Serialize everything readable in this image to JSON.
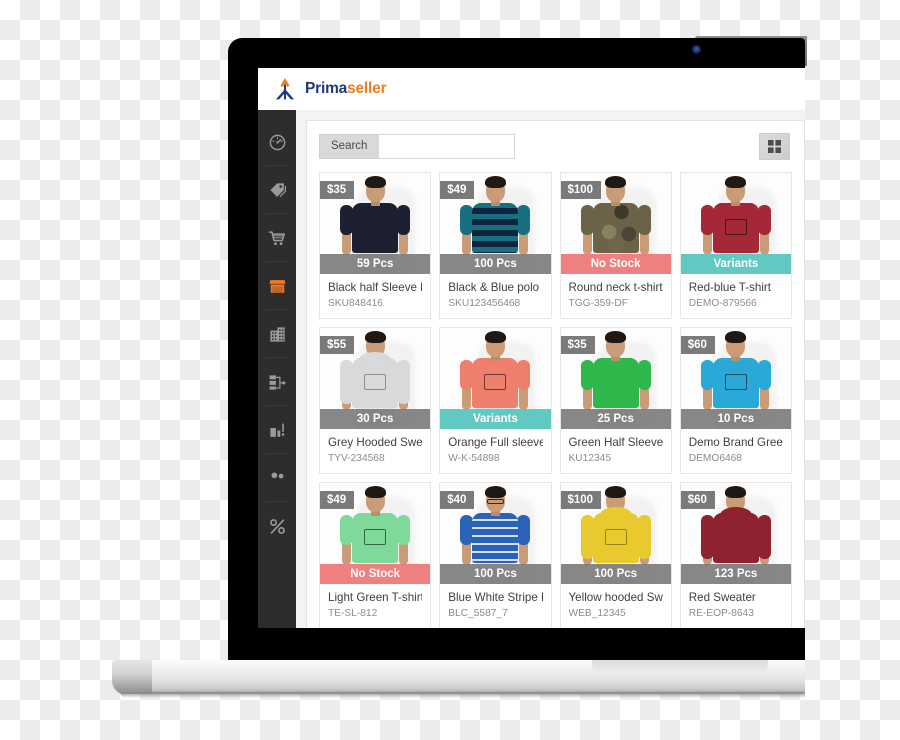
{
  "app": {
    "logo_prima": "Prima",
    "logo_seller": "seller",
    "logo_mark_icon": "primaseller-arrow-icon"
  },
  "sidebar": {
    "items": [
      {
        "icon": "dashboard-gauge-icon",
        "active": false
      },
      {
        "icon": "tag-icon",
        "active": false
      },
      {
        "icon": "shopping-cart-icon",
        "active": false
      },
      {
        "icon": "store-icon",
        "active": true
      },
      {
        "icon": "building-icon",
        "active": false
      },
      {
        "icon": "hierarchy-icon",
        "active": false
      },
      {
        "icon": "bar-chart-icon",
        "active": false
      },
      {
        "icon": "people-icon",
        "active": false
      },
      {
        "icon": "percent-icon",
        "active": false
      }
    ],
    "active_color": "#f47a20",
    "idle_color": "#9a9a9a",
    "background": "#2d2d2d"
  },
  "toolbar": {
    "search_label": "Search",
    "search_value": "",
    "search_placeholder": "",
    "grid_view_icon": "grid-view-icon"
  },
  "colors": {
    "badge_grey": "#767676",
    "badge_red": "#f08080",
    "badge_teal": "#62c8c2",
    "price_tag": "#7a7a7a"
  },
  "products": [
    {
      "price": "$35",
      "stock_label": "59 Pcs",
      "stock_state": "grey",
      "title": "Black half Sleeve Polo",
      "sku": "SKU848416",
      "shirt_color": "#1c2030",
      "style": "polo"
    },
    {
      "price": "$49",
      "stock_label": "100 Pcs",
      "stock_state": "grey",
      "title": "Black & Blue polo",
      "sku": "SKU123456468",
      "shirt_color": "#17707f",
      "style": "striped"
    },
    {
      "price": "$100",
      "stock_label": "No Stock",
      "stock_state": "red",
      "title": "Round neck t-shirt",
      "sku": "TGG-359-DF",
      "shirt_color": "#6b6248",
      "style": "camo"
    },
    {
      "price": "",
      "stock_label": "Variants",
      "stock_state": "teal",
      "title": "Red-blue T-shirt",
      "sku": "DEMO-879566",
      "shirt_color": "#a52839",
      "style": "graphic"
    },
    {
      "price": "$55",
      "stock_label": "30 Pcs",
      "stock_state": "grey",
      "title": "Grey Hooded Sweater",
      "sku": "TYV-234568",
      "shirt_color": "#d7d9da",
      "style": "hoodie"
    },
    {
      "price": "",
      "stock_label": "Variants",
      "stock_state": "teal",
      "title": "Orange Full sleeve",
      "sku": "W-K-54898",
      "shirt_color": "#ee7f6d",
      "style": "graphic"
    },
    {
      "price": "$35",
      "stock_label": "25 Pcs",
      "stock_state": "grey",
      "title": "Green Half Sleeve Polo",
      "sku": "KU12345",
      "shirt_color": "#2eb84c",
      "style": "polo"
    },
    {
      "price": "$60",
      "stock_label": "10 Pcs",
      "stock_state": "grey",
      "title": "Demo Brand Gree",
      "sku": "DEMO6468",
      "shirt_color": "#2aa8d8",
      "style": "graphic"
    },
    {
      "price": "$49",
      "stock_label": "No Stock",
      "stock_state": "red",
      "title": "Light Green T-shirt",
      "sku": "TE-SL-812",
      "shirt_color": "#7fd99a",
      "style": "graphic"
    },
    {
      "price": "$40",
      "stock_label": "100 Pcs",
      "stock_state": "grey",
      "title": "Blue White Stripe Polo",
      "sku": "BLC_5587_7",
      "shirt_color": "#2a63b8",
      "style": "striped-blue"
    },
    {
      "price": "$100",
      "stock_label": "100 Pcs",
      "stock_state": "grey",
      "title": "Yellow hooded Sweater",
      "sku": "WEB_12345",
      "shirt_color": "#e8c92e",
      "style": "hoodie"
    },
    {
      "price": "$60",
      "stock_label": "123 Pcs",
      "stock_state": "grey",
      "title": "Red Sweater",
      "sku": "RE-EOP-8643",
      "shirt_color": "#8e2230",
      "style": "hoodie-plain"
    }
  ]
}
